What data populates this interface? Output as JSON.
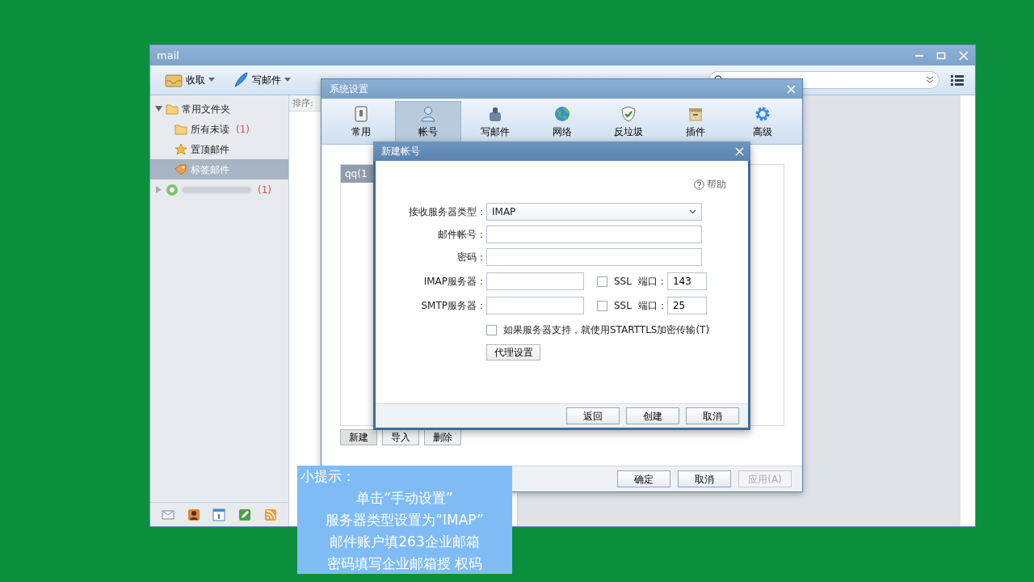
{
  "main_window": {
    "title": "mail",
    "toolbar": [
      {
        "label": "收取"
      },
      {
        "label": "写邮件"
      }
    ],
    "sidebar": {
      "items": [
        {
          "label": "常用文件夹",
          "expanded": true,
          "selected": false,
          "children": [
            {
              "label": "所有未读",
              "count": "(1)",
              "selected": false
            },
            {
              "label": "置顶邮件",
              "selected": false
            },
            {
              "label": "标签邮件",
              "selected": true
            }
          ]
        },
        {
          "count": "(1)",
          "expanded": false,
          "selected": false
        }
      ]
    },
    "message_list": {
      "sort_label": "排序:"
    }
  },
  "settings_dialog": {
    "title": "系统设置",
    "tabs": [
      {
        "label": "常用",
        "selected": false
      },
      {
        "label": "帐号",
        "selected": true
      },
      {
        "label": "写邮件",
        "selected": false
      },
      {
        "label": "网络",
        "selected": false
      },
      {
        "label": "反垃圾",
        "selected": false
      },
      {
        "label": "插件",
        "selected": false
      },
      {
        "label": "高级",
        "selected": false
      }
    ],
    "account_list_header": "qq(1",
    "list_buttons": [
      {
        "label": "新建",
        "selected": true
      },
      {
        "label": "导入",
        "selected": false
      },
      {
        "label": "删除",
        "selected": false
      }
    ],
    "footer_buttons": [
      {
        "label": "确定",
        "disabled": false
      },
      {
        "label": "取消",
        "disabled": false
      },
      {
        "label": "应用(A)",
        "disabled": true
      }
    ]
  },
  "new_account_dialog": {
    "title": "新建帐号",
    "help": "帮助",
    "fields": [
      {
        "kind": "select",
        "label": "接收服务器类型：",
        "value": "IMAP"
      },
      {
        "kind": "text",
        "label": "邮件帐号："
      },
      {
        "kind": "text",
        "label": "密码："
      },
      {
        "kind": "server",
        "label": "IMAP服务器：",
        "ssl_label": "SSL",
        "ssl": false,
        "port_label": "端口：",
        "port": "143"
      },
      {
        "kind": "server",
        "label": "SMTP服务器：",
        "ssl_label": "SSL",
        "ssl": false,
        "port_label": "端口：",
        "port": "25"
      }
    ],
    "starttls": {
      "label": "如果服务器支持，就使用STARTTLS加密传输(T)",
      "checked": false
    },
    "proxy_button": "代理设置",
    "footer_buttons": [
      "返回",
      "创建",
      "取消"
    ]
  },
  "tip": {
    "title": "小提示：",
    "lines": [
      "单击“手动设置”",
      "服务器类型设置为“IMAP”",
      "邮件账户填263企业邮箱",
      "密码填写企业邮箱授 权码"
    ]
  }
}
